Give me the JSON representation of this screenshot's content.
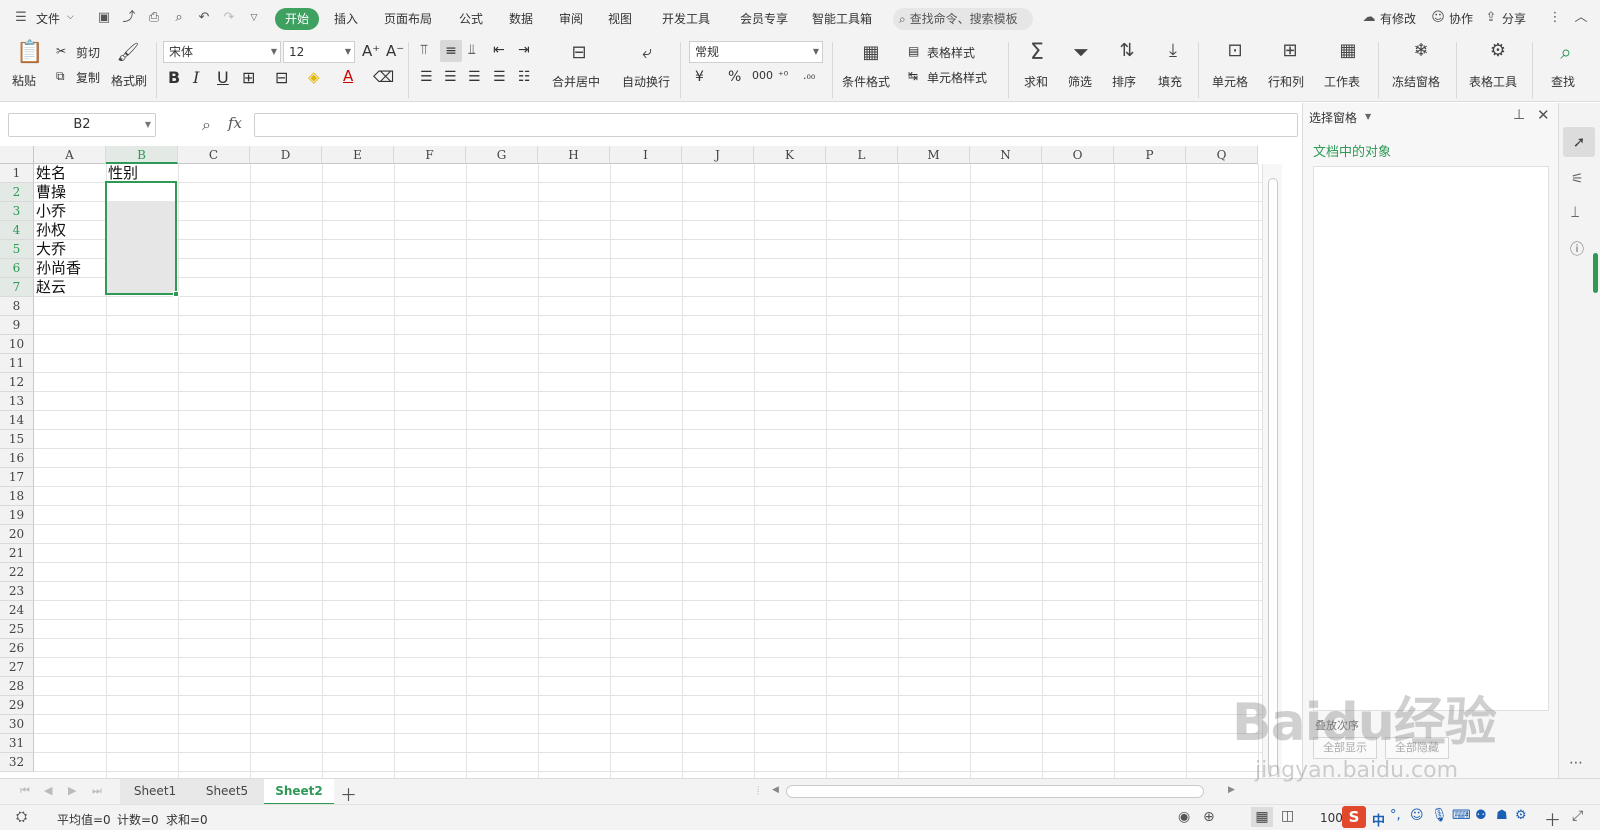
{
  "menubar": {
    "file_label": "文件",
    "tabs": [
      "开始",
      "插入",
      "页面布局",
      "公式",
      "数据",
      "审阅",
      "视图",
      "开发工具",
      "会员专享",
      "智能工具箱"
    ],
    "search_placeholder": "查找命令、搜索模板",
    "modified_label": "有修改",
    "collab_label": "协作",
    "share_label": "分享"
  },
  "ribbon": {
    "paste": "粘贴",
    "cut": "剪切",
    "copy": "复制",
    "format_painter": "格式刷",
    "font_name": "宋体",
    "font_size": "12",
    "number_format": "常规",
    "merge_center": "合并居中",
    "wrap_text": "自动换行",
    "cond_format": "条件格式",
    "table_style": "表格样式",
    "cell_style": "单元格样式",
    "sum": "求和",
    "filter": "筛选",
    "sort": "排序",
    "fill": "填充",
    "cell": "单元格",
    "row_col": "行和列",
    "worksheet": "工作表",
    "freeze": "冻结窗格",
    "table_tools": "表格工具",
    "find": "查找"
  },
  "formula": {
    "name_box": "B2",
    "fx": "fx",
    "content": ""
  },
  "grid": {
    "columns": [
      "A",
      "B",
      "C",
      "D",
      "E",
      "F",
      "G",
      "H",
      "I",
      "J",
      "K",
      "L",
      "M",
      "N",
      "O",
      "P",
      "Q"
    ],
    "rows": [
      "1",
      "2",
      "3",
      "4",
      "5",
      "6",
      "7",
      "8",
      "9",
      "10",
      "11",
      "12",
      "13",
      "14",
      "15",
      "16",
      "17",
      "18",
      "19",
      "20",
      "21",
      "22",
      "23",
      "24",
      "25",
      "26",
      "27",
      "28",
      "29",
      "30",
      "31",
      "32"
    ],
    "cells": {
      "A1": "姓名",
      "B1": "性别",
      "A2": "曹操",
      "A3": "小乔",
      "A4": "孙权",
      "A5": "大乔",
      "A6": "孙尚香",
      "A7": "赵云"
    },
    "selection": "B2:B7"
  },
  "panel": {
    "title": "选择窗格",
    "subtitle": "文档中的对象",
    "show_all": "全部显示",
    "hide_all": "全部隐藏",
    "order_label": "叠放次序"
  },
  "sheets": {
    "tabs": [
      "Sheet1",
      "Sheet5",
      "Sheet2"
    ],
    "active": "Sheet2"
  },
  "status": {
    "avg": "平均值=0",
    "count": "计数=0",
    "sum": "求和=0",
    "zoom": "100",
    "ime": "中"
  },
  "watermark": {
    "brand": "Baidu经验",
    "url": "jingyan.baidu.com"
  },
  "colors": {
    "accent": "#3fa160",
    "selection": "#2e9a55"
  }
}
